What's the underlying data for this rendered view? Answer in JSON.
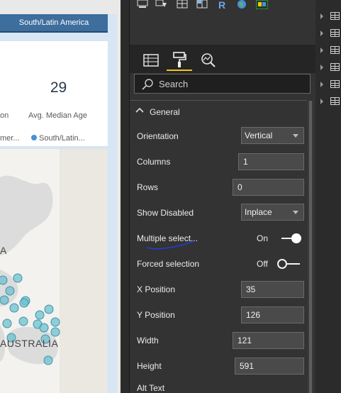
{
  "report": {
    "card_title": "South/Latin America",
    "kpi_value": "29",
    "kpi_label": "Avg. Median Age",
    "kpi_label_left_fragment": "on",
    "legend_left_fragment": "mer...",
    "legend_item": "South/Latin...",
    "map_label_a": "A",
    "map_label_australia": "AUSTRALIA"
  },
  "format_pane": {
    "tabs": [
      {
        "name": "fields-tab",
        "icon": "fields-grid-icon"
      },
      {
        "name": "format-tab",
        "icon": "paint-roller-icon",
        "active": true
      },
      {
        "name": "analytics-tab",
        "icon": "magnifier-chart-icon"
      }
    ],
    "search": {
      "placeholder": "Search"
    },
    "section": {
      "title": "General"
    },
    "properties": {
      "orientation": {
        "label": "Orientation",
        "value": "Vertical"
      },
      "columns": {
        "label": "Columns",
        "value": "1"
      },
      "rows": {
        "label": "Rows",
        "value": "0"
      },
      "show_disabled": {
        "label": "Show Disabled",
        "value": "Inplace"
      },
      "multiple_select": {
        "label": "Multiple select...",
        "state": "On"
      },
      "forced_selection": {
        "label": "Forced selection",
        "state": "Off"
      },
      "x_position": {
        "label": "X Position",
        "value": "35"
      },
      "y_position": {
        "label": "Y Position",
        "value": "126"
      },
      "width": {
        "label": "Width",
        "value": "121"
      },
      "height": {
        "label": "Height",
        "value": "591"
      },
      "alt_text": {
        "label": "Alt Text"
      }
    }
  },
  "colors": {
    "accent": "#f2c811",
    "card_header": "#3d6e9e",
    "map_marker": "#6fc0cf",
    "annotation_ink": "#1f3fd6"
  }
}
